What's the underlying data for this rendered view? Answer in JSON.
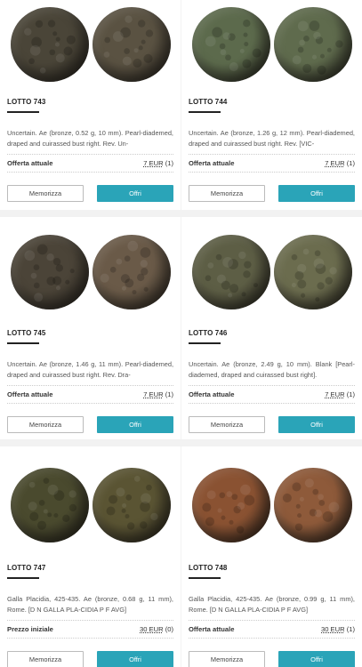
{
  "labels": {
    "save": "Memorizza",
    "offer": "Offri"
  },
  "lots": [
    {
      "title": "LOTTO 743",
      "description": "Uncertain. Ae (bronze, 0.52 g, 10 mm). Pearl-diademed, draped and cuirassed bust right. Rev. Un-",
      "price_label": "Offerta attuale",
      "price": "7 EUR",
      "bids": "(1)",
      "coin_colors": [
        "#4a4538",
        "#5a5242"
      ]
    },
    {
      "title": "LOTTO 744",
      "description": "Uncertain. Ae (bronze, 1.26 g, 12 mm). Pearl-diademed, draped and cuirassed bust right. Rev. [VIC-",
      "price_label": "Offerta attuale",
      "price": "7 EUR",
      "bids": "(1)",
      "coin_colors": [
        "#5c6a4c",
        "#5f6b4d"
      ]
    },
    {
      "title": "LOTTO 745",
      "description": "Uncertain. Ae (bronze, 1.46 g, 11 mm). Pearl-diademed, draped and cuirassed bust right. Rev. Dra-",
      "price_label": "Offerta attuale",
      "price": "7 EUR",
      "bids": "(1)",
      "coin_colors": [
        "#4b4438",
        "#6a5a48"
      ]
    },
    {
      "title": "LOTTO 746",
      "description": "Uncertain. Ae (bronze, 2.49 g, 10 mm). Blank [Pearl-diademed, draped and cuirassed bust right].",
      "price_label": "Offerta attuale",
      "price": "7 EUR",
      "bids": "(1)",
      "coin_colors": [
        "#5d5e45",
        "#6b6c4e"
      ]
    },
    {
      "title": "LOTTO 747",
      "description": "Galla Placidia, 425-435. Ae (bronze, 0.68 g, 11 mm), Rome. [D N GALLA PLA-CIDIA P F AVG]",
      "price_label": "Prezzo iniziale",
      "price": "30 EUR",
      "bids": "(0)",
      "coin_colors": [
        "#4a4a2e",
        "#5a5433"
      ]
    },
    {
      "title": "LOTTO 748",
      "description": "Galla Placidia, 425-435. Ae (bronze, 0.99 g, 11 mm), Rome. [D N GALLA PLA-CIDIA P F AVG]",
      "price_label": "Offerta attuale",
      "price": "30 EUR",
      "bids": "(1)",
      "coin_colors": [
        "#8a5232",
        "#8e5a3a"
      ]
    }
  ]
}
